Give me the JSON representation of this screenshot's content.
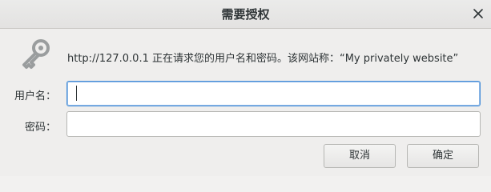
{
  "dialog": {
    "title": "需要授权",
    "message": "http://127.0.0.1 正在请求您的用户名和密码。该网站称：“My privately website”",
    "username_label": "用户名：",
    "password_label": "密码：",
    "username_value": "",
    "password_value": "",
    "cancel_label": "取消",
    "ok_label": "确定"
  },
  "icons": {
    "key": "key-icon",
    "close": "close-icon"
  },
  "colors": {
    "focus_border": "#4a90d9",
    "background": "#efeeed"
  }
}
